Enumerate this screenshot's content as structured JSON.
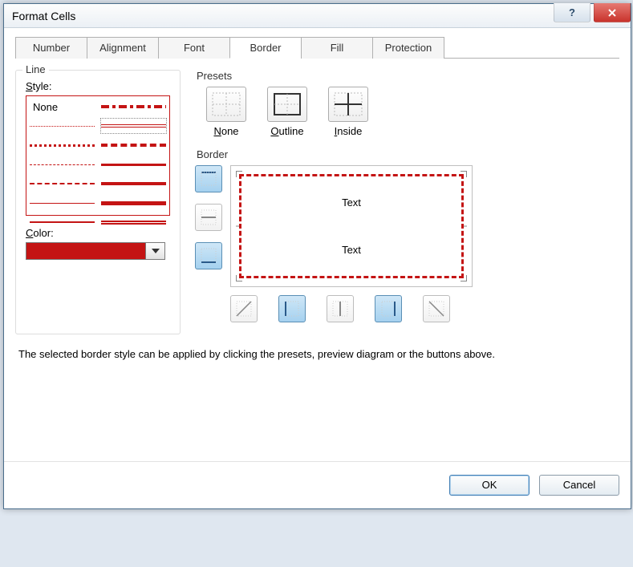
{
  "window": {
    "title": "Format Cells"
  },
  "tabs": [
    "Number",
    "Alignment",
    "Font",
    "Border",
    "Fill",
    "Protection"
  ],
  "active_tab": "Border",
  "line": {
    "group_label": "Line",
    "style_label": "Style:",
    "none_label": "None",
    "color_label": "Color:",
    "color_value": "#c41414"
  },
  "presets": {
    "label": "Presets",
    "items": [
      {
        "id": "none",
        "label_pre": "",
        "label_u": "N",
        "label_post": "one"
      },
      {
        "id": "outline",
        "label_pre": "",
        "label_u": "O",
        "label_post": "utline"
      },
      {
        "id": "inside",
        "label_pre": "",
        "label_u": "I",
        "label_post": "nside"
      }
    ]
  },
  "border": {
    "label": "Border",
    "preview_text1": "Text",
    "preview_text2": "Text"
  },
  "hint": "The selected border style can be applied by clicking the presets, preview diagram or the buttons above.",
  "buttons": {
    "ok": "OK",
    "cancel": "Cancel"
  }
}
